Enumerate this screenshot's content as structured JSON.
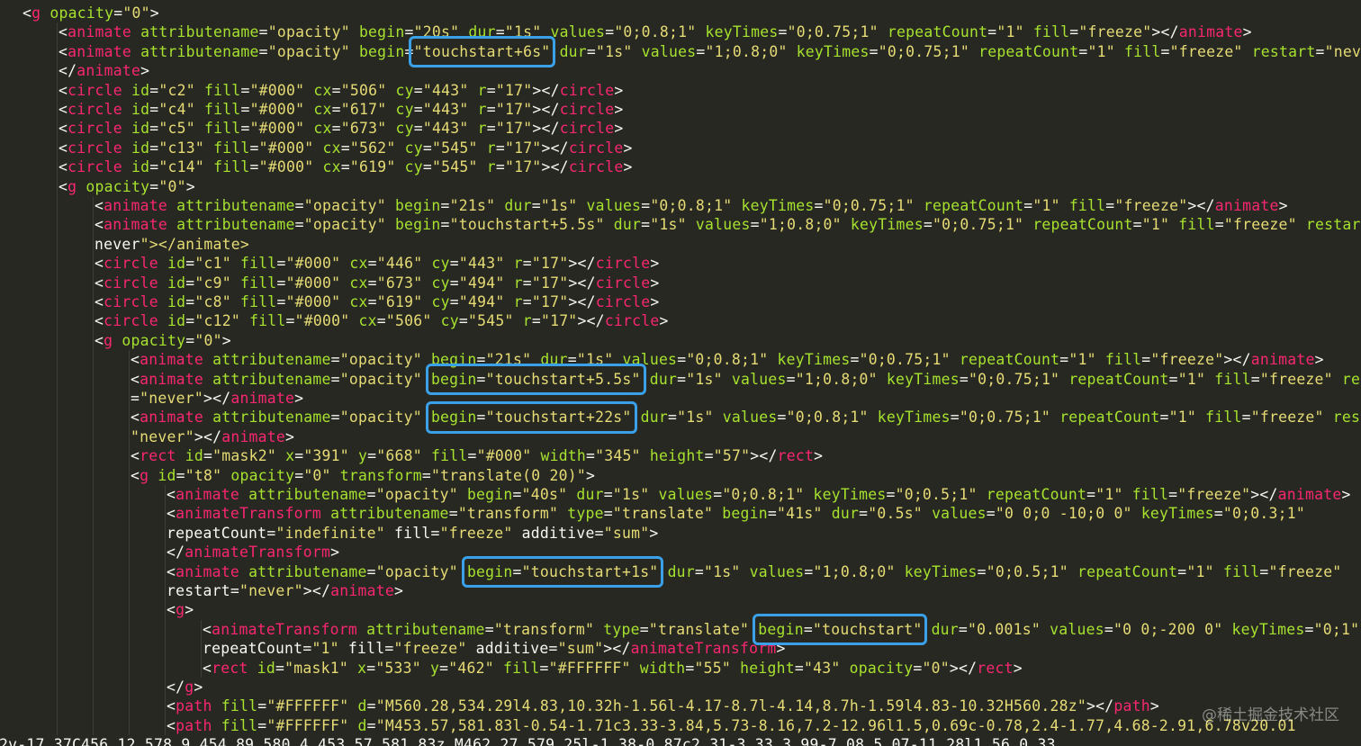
{
  "editor": {
    "theme_colors": {
      "background": "#272822",
      "punctuation": "#f8f8f2",
      "tag": "#f92672",
      "attribute": "#a6e22e",
      "string": "#e6db74",
      "highlight_box": "#3aa0e8"
    },
    "lines": [
      {
        "indent": 1,
        "text": "<g opacity=\"0\">"
      },
      {
        "indent": 2,
        "text": "<animate attributename=\"opacity\" begin=\"20s\" dur=\"1s\" values=\"0;0.8;1\" keyTimes=\"0;0.75;1\" repeatCount=\"1\" fill=\"freeze\"></animate>"
      },
      {
        "indent": 2,
        "text": "<animate attributename=\"opacity\" begin=\"touchstart+6s\" dur=\"1s\" values=\"1;0.8;0\" keyTimes=\"0;0.75;1\" repeatCount=\"1\" fill=\"freeze\" restart=\"never\""
      },
      {
        "indent": 2,
        "text": "</animate>"
      },
      {
        "indent": 2,
        "text": "<circle id=\"c2\" fill=\"#000\" cx=\"506\" cy=\"443\" r=\"17\"></circle>"
      },
      {
        "indent": 2,
        "text": "<circle id=\"c4\" fill=\"#000\" cx=\"617\" cy=\"443\" r=\"17\"></circle>"
      },
      {
        "indent": 2,
        "text": "<circle id=\"c5\" fill=\"#000\" cx=\"673\" cy=\"443\" r=\"17\"></circle>"
      },
      {
        "indent": 2,
        "text": "<circle id=\"c13\" fill=\"#000\" cx=\"562\" cy=\"545\" r=\"17\"></circle>"
      },
      {
        "indent": 2,
        "text": "<circle id=\"c14\" fill=\"#000\" cx=\"619\" cy=\"545\" r=\"17\"></circle>"
      },
      {
        "indent": 2,
        "text": "<g opacity=\"0\">"
      },
      {
        "indent": 3,
        "text": "<animate attributename=\"opacity\" begin=\"21s\" dur=\"1s\" values=\"0;0.8;1\" keyTimes=\"0;0.75;1\" repeatCount=\"1\" fill=\"freeze\"></animate>"
      },
      {
        "indent": 3,
        "text": "<animate attributename=\"opacity\" begin=\"touchstart+5.5s\" dur=\"1s\" values=\"1;0.8;0\" keyTimes=\"0;0.75;1\" repeatCount=\"1\" fill=\"freeze\" restart="
      },
      {
        "indent": 3,
        "text": "never\"></animate>"
      },
      {
        "indent": 3,
        "text": "<circle id=\"c1\" fill=\"#000\" cx=\"446\" cy=\"443\" r=\"17\"></circle>"
      },
      {
        "indent": 3,
        "text": "<circle id=\"c9\" fill=\"#000\" cx=\"673\" cy=\"494\" r=\"17\"></circle>"
      },
      {
        "indent": 3,
        "text": "<circle id=\"c8\" fill=\"#000\" cx=\"619\" cy=\"494\" r=\"17\"></circle>"
      },
      {
        "indent": 3,
        "text": "<circle id=\"c12\" fill=\"#000\" cx=\"506\" cy=\"545\" r=\"17\"></circle>"
      },
      {
        "indent": 3,
        "text": "<g opacity=\"0\">"
      },
      {
        "indent": 4,
        "text": "<animate attributename=\"opacity\" begin=\"21s\" dur=\"1s\" values=\"0;0.8;1\" keyTimes=\"0;0.75;1\" repeatCount=\"1\" fill=\"freeze\"></animate>"
      },
      {
        "indent": 4,
        "text": "<animate attributename=\"opacity\" begin=\"touchstart+5.5s\" dur=\"1s\" values=\"1;0.8;0\" keyTimes=\"0;0.75;1\" repeatCount=\"1\" fill=\"freeze\" rest"
      },
      {
        "indent": 4,
        "text": "=\"never\"></animate>"
      },
      {
        "indent": 4,
        "text": "<animate attributename=\"opacity\" begin=\"touchstart+22s\" dur=\"1s\" values=\"0;0.8;1\" keyTimes=\"0;0.75;1\" repeatCount=\"1\" fill=\"freeze\" resta"
      },
      {
        "indent": 4,
        "text": "\"never\"></animate>"
      },
      {
        "indent": 4,
        "text": "<rect id=\"mask2\" x=\"391\" y=\"668\" fill=\"#000\" width=\"345\" height=\"57\"></rect>"
      },
      {
        "indent": 4,
        "text": "<g id=\"t8\" opacity=\"0\" transform=\"translate(0 20)\">"
      },
      {
        "indent": 5,
        "text": "<animate attributename=\"opacity\" begin=\"40s\" dur=\"1s\" values=\"0;0.8;1\" keyTimes=\"0;0.5;1\" repeatCount=\"1\" fill=\"freeze\"></animate>"
      },
      {
        "indent": 5,
        "text": "<animateTransform attributename=\"transform\" type=\"translate\" begin=\"41s\" dur=\"0.5s\" values=\"0 0;0 -10;0 0\" keyTimes=\"0;0.3;1\""
      },
      {
        "indent": 5,
        "text": "repeatCount=\"indefinite\" fill=\"freeze\" additive=\"sum\">"
      },
      {
        "indent": 5,
        "text": "</animateTransform>"
      },
      {
        "indent": 5,
        "text": "<animate attributename=\"opacity\" begin=\"touchstart+1s\" dur=\"1s\" values=\"1;0.8;0\" keyTimes=\"0;0.5;1\" repeatCount=\"1\" fill=\"freeze\""
      },
      {
        "indent": 5,
        "text": "restart=\"never\"></animate>"
      },
      {
        "indent": 5,
        "text": "<g>"
      },
      {
        "indent": 6,
        "text": "<animateTransform attributename=\"transform\" type=\"translate\" begin=\"touchstart\" dur=\"0.001s\" values=\"0 0;-200 0\" keyTimes=\"0;1\""
      },
      {
        "indent": 6,
        "text": "repeatCount=\"1\" fill=\"freeze\" additive=\"sum\"></animateTransform>"
      },
      {
        "indent": 6,
        "text": "<rect id=\"mask1\" x=\"533\" y=\"462\" fill=\"#FFFFFF\" width=\"55\" height=\"43\" opacity=\"0\"></rect>"
      },
      {
        "indent": 5,
        "text": "</g>"
      },
      {
        "indent": 5,
        "text": "<path fill=\"#FFFFFF\" d=\"M560.28,534.29l4.83,10.32h-1.56l-4.17-8.7l-4.14,8.7h-1.59l4.83-10.32H560.28z\"></path>"
      },
      {
        "indent": 5,
        "text": "<path fill=\"#FFFFFF\" d=\"M453.57,581.83l-0.54-1.71c3.33-3.84,5.73-8.16,7.2-12.96l1.5,0.69c-0.78,2.4-1.77,4.68-2.91,6.78v20.01"
      },
      {
        "indent": 0,
        "text": "2v-17.37C456.12,578.9,454.89,580.4,453.57,581.83z M462.27,579.25l-1.38-0.87c2.31-3.33,3.99-7.08,5.07-11.28l1.56,0.33"
      }
    ],
    "highlights": [
      {
        "line": 2,
        "match": "\"touchstart+6s\""
      },
      {
        "line": 19,
        "match": "begin=\"touchstart+5.5s\""
      },
      {
        "line": 21,
        "match": "begin=\"touchstart+22s\""
      },
      {
        "line": 29,
        "match": "begin=\"touchstart+1s\""
      },
      {
        "line": 32,
        "match": "begin=\"touchstart\""
      }
    ]
  },
  "watermark": {
    "text": "@稀土掘金技术社区"
  }
}
